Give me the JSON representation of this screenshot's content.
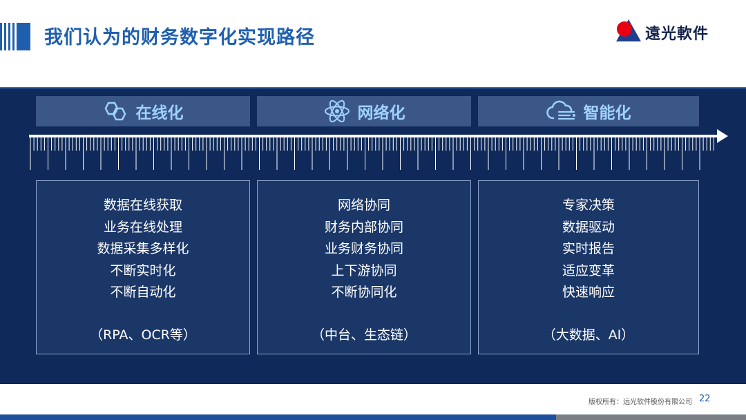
{
  "slide": {
    "title": "我们认为的财务数字化实现路径",
    "logo_text": "遠光軟件",
    "copyright": "版权所有：远光软件股份有限公司",
    "page_number": "22"
  },
  "colors": {
    "brand_blue": "#1f5fae",
    "panel_bg": "#0f2a5a",
    "header_bg": "#3b5788",
    "header_text": "#9fd2ff",
    "card_bg": "#1b3768",
    "logo_red": "#e60012"
  },
  "stages": [
    {
      "label": "在线化",
      "icon": "link-hexagon-icon",
      "items": [
        "数据在线获取",
        "业务在线处理",
        "数据采集多样化",
        "不断实时化",
        "不断自动化"
      ],
      "note": "（RPA、OCR等）"
    },
    {
      "label": "网络化",
      "icon": "atom-network-icon",
      "items": [
        "网络协同",
        "财务内部协同",
        "业务财务协同",
        "上下游协同",
        "不断协同化"
      ],
      "note": "（中台、生态链）"
    },
    {
      "label": "智能化",
      "icon": "cloud-data-icon",
      "items": [
        "专家决策",
        "数据驱动",
        "实时报告",
        "适应变革",
        "快速响应"
      ],
      "note": "（大数据、AI）"
    }
  ]
}
